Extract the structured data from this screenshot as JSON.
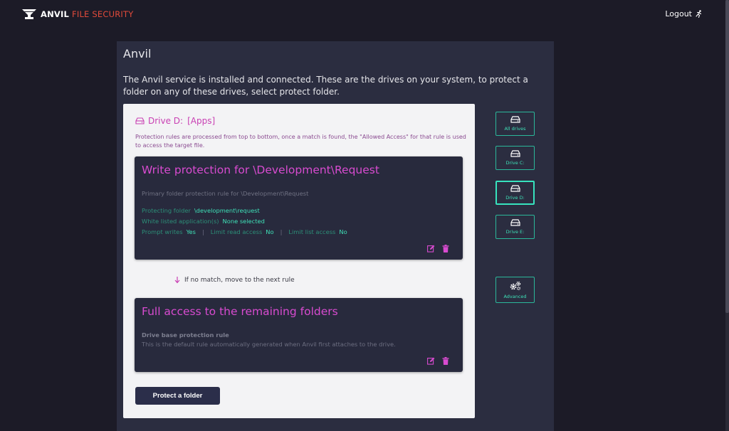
{
  "header": {
    "brand_primary": "ANVIL",
    "brand_secondary": "FILE SECURITY",
    "logout_label": "Logout"
  },
  "main": {
    "title": "Anvil",
    "intro": "The Anvil service is installed and connected. These are the drives on your system, to protect a folder on any of these drives, select protect folder."
  },
  "drive": {
    "title": "Drive D:",
    "label": "[Apps]",
    "note": "Protection rules are processed from top to bottom, once a match is found, the \"Allowed Access\" for that rule is used to access the target file."
  },
  "rules": [
    {
      "title": "Write protection for \\Development\\Request",
      "description": "Primary folder protection rule for \\Development\\Request",
      "protecting_folder_label": "Protecting folder",
      "protecting_folder_value": "\\development\\request",
      "whitelisted_label": "White listed application(s)",
      "whitelisted_value": "None selected",
      "prompt_writes_label": "Prompt writes",
      "prompt_writes_value": "Yes",
      "limit_read_label": "Limit read access",
      "limit_read_value": "No",
      "limit_list_label": "Limit list access",
      "limit_list_value": "No",
      "separator": "|"
    },
    {
      "title": "Full access to the remaining folders",
      "subtitle": "Drive base protection rule",
      "description": "This is the default rule automatically generated when Anvil first attaches to the drive."
    }
  ],
  "next_rule_text": "If no match, move to the next rule",
  "protect_button_label": "Protect a folder",
  "sidebar": {
    "items": [
      {
        "label": "All drives",
        "icon": "hdd-icon"
      },
      {
        "label": "Drive C:",
        "icon": "hdd-icon"
      },
      {
        "label": "Drive D:",
        "icon": "hdd-icon",
        "active": true
      },
      {
        "label": "Drive E:",
        "icon": "hdd-icon"
      }
    ],
    "advanced_label": "Advanced",
    "advanced_icon": "gears-icon"
  },
  "colors": {
    "background": "#1c1b27",
    "panel": "#2b2d40",
    "card": "#f3f3f5",
    "rule_bg": "#282a3d",
    "magenta_accent": "#d84bd0",
    "teal_accent": "#3ee0b7",
    "brand_red": "#e04a3a"
  }
}
